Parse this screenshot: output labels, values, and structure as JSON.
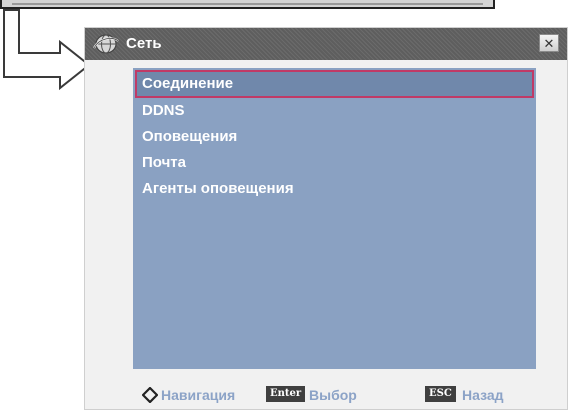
{
  "window": {
    "title": "Сеть",
    "close_glyph": "✕",
    "icon": "globe-network-icon"
  },
  "menu": {
    "items": [
      {
        "label": "Соединение",
        "selected": true
      },
      {
        "label": "DDNS",
        "selected": false
      },
      {
        "label": "Оповещения",
        "selected": false
      },
      {
        "label": "Почта",
        "selected": false
      },
      {
        "label": "Агенты оповещения",
        "selected": false
      }
    ]
  },
  "footer": {
    "nav_label": "Навигация",
    "enter_key": "Enter",
    "enter_label": "Выбор",
    "esc_key": "ESC",
    "esc_label": "Назад"
  },
  "colors": {
    "content_bg": "#8aa1c2",
    "selection_border": "#c03a66",
    "footer_text": "#8ca3c7",
    "title_text": "#ffffff"
  }
}
